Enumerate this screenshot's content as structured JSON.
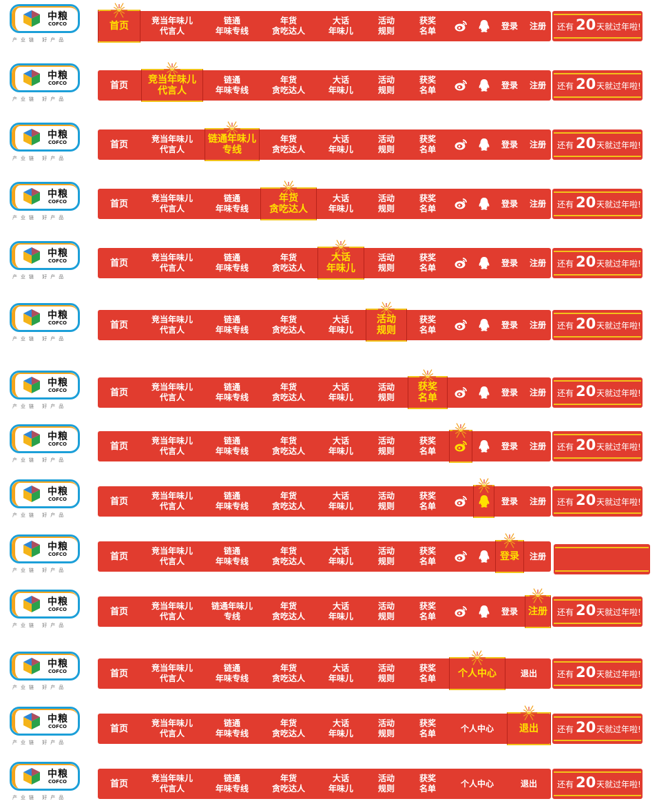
{
  "brand": {
    "name_cn": "中粮",
    "name_en": "COFCO",
    "slogan": "产业链 好产品"
  },
  "nav_a": [
    {
      "key": "home",
      "label": "首页"
    },
    {
      "key": "spokesperson",
      "label": "竞当年味儿\n代言人"
    },
    {
      "key": "special_line",
      "label": "链通\n年味专线"
    },
    {
      "key": "foodie",
      "label": "年货\n贪吃达人"
    },
    {
      "key": "talk",
      "label": "大话\n年味儿"
    },
    {
      "key": "rules",
      "label": "活动\n规则"
    },
    {
      "key": "winners",
      "label": "获奖\n名单"
    },
    {
      "key": "weibo",
      "icon": "weibo-icon"
    },
    {
      "key": "qq",
      "icon": "qq-penguin-icon"
    },
    {
      "key": "login",
      "label": "登录"
    },
    {
      "key": "register",
      "label": "注册"
    }
  ],
  "nav_b": [
    {
      "key": "home",
      "label": "首页"
    },
    {
      "key": "spokesperson",
      "label": "竞当年味儿\n代言人"
    },
    {
      "key": "special_line",
      "label": "链通\n年味专线"
    },
    {
      "key": "foodie",
      "label": "年货\n贪吃达人"
    },
    {
      "key": "talk",
      "label": "大话\n年味儿"
    },
    {
      "key": "rules",
      "label": "活动\n规则"
    },
    {
      "key": "winners",
      "label": "获奖\n名单"
    },
    {
      "key": "user_center",
      "label": "个人中心"
    },
    {
      "key": "logout",
      "label": "退出"
    }
  ],
  "alt_labels": {
    "special_line_inline": "链通年味儿\n专线"
  },
  "countdown": {
    "prefix": "还有",
    "days": "20",
    "suffix": "天就过年啦!"
  },
  "states": [
    {
      "active": "home",
      "nav": "a"
    },
    {
      "active": "spokesperson",
      "nav": "a"
    },
    {
      "active": "special_line",
      "nav": "a",
      "special_line_alt": true
    },
    {
      "active": "foodie",
      "nav": "a"
    },
    {
      "active": "talk",
      "nav": "a"
    },
    {
      "active": "rules",
      "nav": "a"
    },
    {
      "active": "winners",
      "nav": "a"
    },
    {
      "active": "weibo",
      "nav": "a"
    },
    {
      "active": "qq",
      "nav": "a"
    },
    {
      "active": "login",
      "nav": "a",
      "hide_countdown_text": true
    },
    {
      "active": "register",
      "nav": "a",
      "special_line_alt": true
    },
    {
      "active": "user_center",
      "nav": "b"
    },
    {
      "active": "logout",
      "nav": "b"
    },
    {
      "active": "none",
      "nav": "b"
    }
  ],
  "colors": {
    "bar": "#e13c2f",
    "active_text": "#ffe100",
    "gold_line": "#f2c319"
  }
}
